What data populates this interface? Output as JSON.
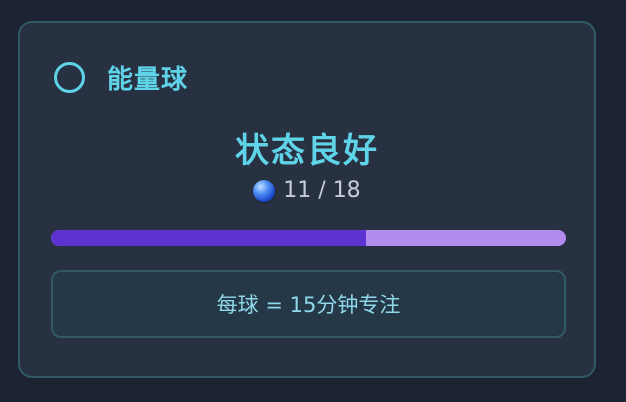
{
  "widget": {
    "title": "能量球",
    "status": "状态良好",
    "icon": "energy-orb-icon",
    "current": 11,
    "total": 18,
    "count_text": "11 / 18",
    "progress_fraction": 0.611,
    "note": "每球 = 15分钟专注"
  },
  "colors": {
    "accent": "#5fd3e8",
    "progress_fill": "#5c33d0",
    "progress_track": "#b48cf0",
    "card_border": "#2f5a66"
  }
}
